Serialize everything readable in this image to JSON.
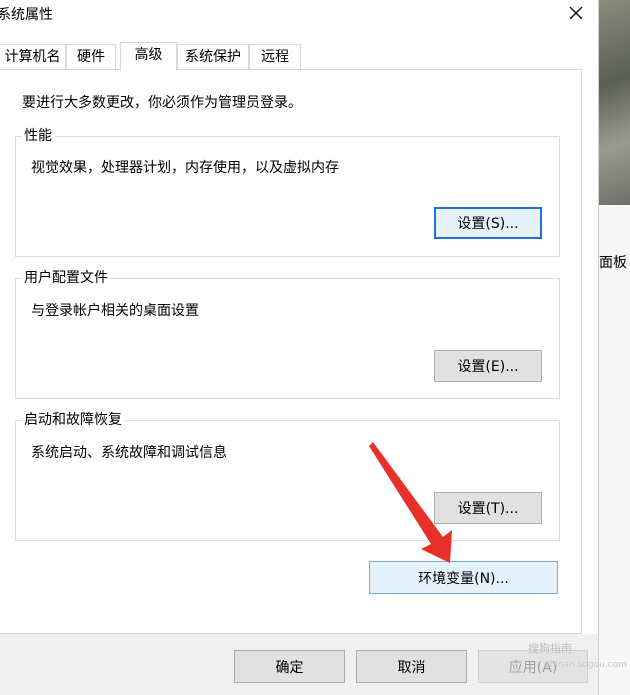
{
  "window": {
    "title": "系统属性"
  },
  "tabs": [
    {
      "label": "计算机名"
    },
    {
      "label": "硬件"
    },
    {
      "label": "高级"
    },
    {
      "label": "系统保护"
    },
    {
      "label": "远程"
    }
  ],
  "intro": "要进行大多数更改，你必须作为管理员登录。",
  "performance": {
    "title": "性能",
    "desc": "视觉效果，处理器计划，内存使用，以及虚拟内存",
    "button": "设置(S)..."
  },
  "profile": {
    "title": "用户配置文件",
    "desc": "与登录帐户相关的桌面设置",
    "button": "设置(E)..."
  },
  "startup": {
    "title": "启动和故障恢复",
    "desc": "系统启动、系统故障和调试信息",
    "button": "设置(T)..."
  },
  "env_button": "环境变量(N)...",
  "footer": {
    "ok": "确定",
    "cancel": "取消",
    "apply": "应用(A)"
  },
  "background": {
    "partial_label": "面板"
  },
  "watermark": {
    "main": "搜狗指南",
    "sub": "zhinan.sogou.com"
  },
  "colors": {
    "arrow": "#e8302a",
    "focus_border": "#1e72c8"
  }
}
